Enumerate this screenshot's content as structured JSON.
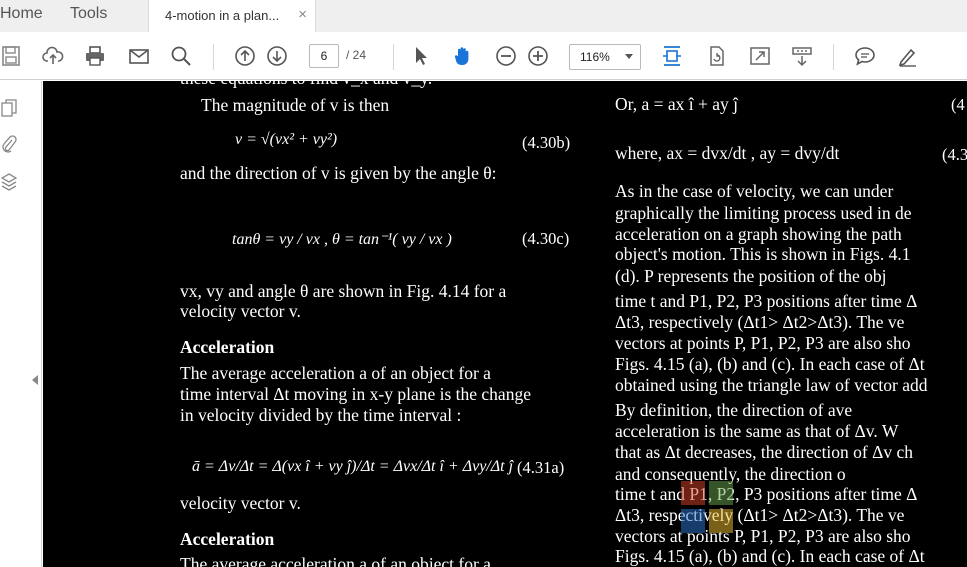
{
  "menu": {
    "home": "Home",
    "tools": "Tools"
  },
  "tab": {
    "title": "4-motion in a plan...",
    "close": "×"
  },
  "toolbar": {
    "icons": [
      "save-icon",
      "cloud-upload-icon",
      "print-icon",
      "email-icon",
      "search-icon",
      "page-up-icon",
      "page-down-icon",
      "select-cursor-icon",
      "hand-tool-icon",
      "zoom-out-icon",
      "zoom-in-icon",
      "fit-width-icon",
      "rotate-page-icon",
      "full-screen-icon",
      "read-mode-icon",
      "comment-icon",
      "sign-icon"
    ],
    "page_current": "6",
    "page_total": "/ 24",
    "zoom": "116%"
  },
  "leftpane": {
    "icons": [
      "pages-icon",
      "attachment-icon",
      "layers-icon"
    ]
  },
  "left_column": {
    "line_clipped": "these equations to find v_x and v_y.",
    "magnitude_line": "The magnitude of v is then",
    "eq_430b": "v = √(vx² + vy²)",
    "eq_430b_num": "(4.30b)",
    "direction_line": "and the direction of v is given by the angle θ:",
    "eq_430c": "tanθ = vy / vx ,   θ = tan⁻¹( vy / vx )",
    "eq_430c_num": "(4.30c)",
    "para1_line1": "vx, vy and angle θ are shown in Fig. 4.14 for a",
    "para1_line2": "velocity vector v.",
    "heading_accel": "Acceleration",
    "para2_line1": "The average acceleration  a of an object for a",
    "para2_line2": "time interval Δt moving in x-y plane is the change",
    "para2_line3": "in velocity divided by the time interval :",
    "eq_431a": "ā = Δv/Δt = Δ(vx î + vy ĵ)/Δt = Δvx/Δt î + Δvy/Δt ĵ",
    "eq_431a_num": "(4.31a)",
    "dup_line": "velocity vector v.",
    "dup_heading": "Acceleration",
    "dup_para": "The average acceleration  a of an object for a"
  },
  "right_column": {
    "or_line": "Or,      a = ax î + ay ĵ",
    "or_num": "(4",
    "where_line": "where,        ax = dvx/dt ,  ay = dvy/dt",
    "where_num": "(4.3",
    "p1": "As in the case of velocity, we can under",
    "p2": "graphically the limiting process used in de",
    "p3": "acceleration on a graph showing the path",
    "p4": "object's motion. This is shown in Figs. 4.1",
    "p5": "(d).  P represents the position of the obj",
    "p6": "time t and P1, P2, P3 positions after time Δ",
    "p7": "Δt3, respectively (Δt1> Δt2>Δt3). The ve",
    "p8": "vectors at points P, P1, P2, P3 are also sho",
    "p9": "Figs. 4.15 (a), (b) and (c). In each case of Δt",
    "p10": "obtained using the triangle law of vector add",
    "p11": "By definition, the direction of ave",
    "p12": "acceleration is the same as that of Δv. W",
    "p13": "that as Δt decreases, the direction of Δv ch",
    "p14": "and consequently, the direction o",
    "p15": "time t and P1, P2, P3 positions after time Δ",
    "p16": "Δt3, respectively (Δt1> Δt2>Δt3). The ve",
    "p17": "vectors at points P, P1, P2, P3 are also sho",
    "p18": "Figs. 4.15 (a), (b) and (c). In each case of Δt"
  }
}
